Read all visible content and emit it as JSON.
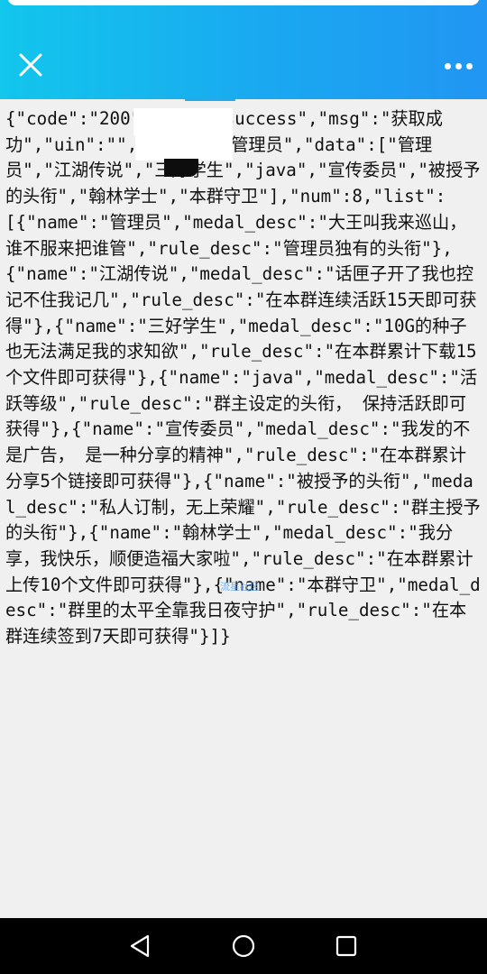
{
  "header": {
    "close_icon": "close-icon",
    "more_icon": "more-dots-icon",
    "background_gradient": [
      "#12c6ec",
      "#2196f3"
    ]
  },
  "content": {
    "json_text": "{\"code\":\"200\",\"msg\":\"success\",\"msg\":\"获取成功\",\"uin\":\"\",\"title\":\"管理员\",\"data\":[\"管理员\",\"江湖传说\",\"三好学生\",\"java\",\"宣传委员\",\"被授予的头衔\",\"翰林学士\",\"本群守卫\"],\"num\":8,\"list\":[{\"name\":\"管理员\",\"medal_desc\":\"大王叫我来巡山，谁不服来把谁管\",\"rule_desc\":\"管理员独有的头衔\"},{\"name\":\"江湖传说\",\"medal_desc\":\"话匣子开了我也控记不住我记几\",\"rule_desc\":\"在本群连续活跃15天即可获得\"},{\"name\":\"三好学生\",\"medal_desc\":\"10G的种子也无法满足我的求知欲\",\"rule_desc\":\"在本群累计下载15个文件即可获得\"},{\"name\":\"java\",\"medal_desc\":\"活跃等级\",\"rule_desc\":\"群主设定的头衔， 保持活跃即可获得\"},{\"name\":\"宣传委员\",\"medal_desc\":\"我发的不是广告， 是一种分享的精神\",\"rule_desc\":\"在本群累计分享5个链接即可获得\"},{\"name\":\"被授予的头衔\",\"medal_desc\":\"私人订制，无上荣耀\",\"rule_desc\":\"群主授予的头衔\"},{\"name\":\"翰林学士\",\"medal_desc\":\"我分享，我快乐，顺便造福大家啦\",\"rule_desc\":\"在本群累计上传10个文件即可获得\"},{\"name\":\"本群守卫\",\"medal_desc\":\"群里的太平全靠我日夜守护\",\"rule_desc\":\"在本群连续签到7天即可获得\"}]}",
    "watermark": "流星社区"
  },
  "navbar": {
    "back_icon": "back-triangle-icon",
    "home_icon": "home-circle-icon",
    "recents_icon": "recents-square-icon"
  }
}
